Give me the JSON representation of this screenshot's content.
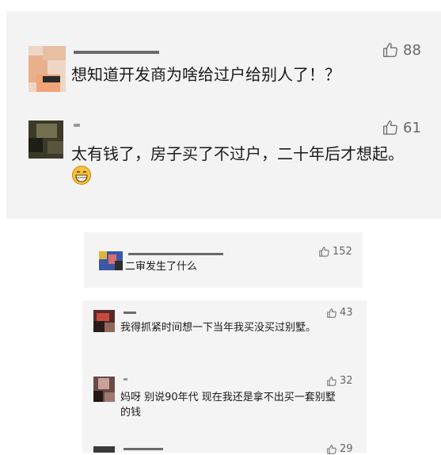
{
  "panel1": {
    "comments": [
      {
        "likes": "88",
        "text": "想知道开发商为啥给过户给别人了！？"
      },
      {
        "likes": "61",
        "text": "太有钱了，房子买了不过户，二十年后才想起。"
      }
    ],
    "emoji_icon": "grinning-face-icon"
  },
  "panel2": {
    "comments": [
      {
        "likes": "152",
        "text": "二审发生了什么"
      }
    ]
  },
  "panel3": {
    "comments": [
      {
        "likes": "43",
        "text": "我得抓紧时间想一下当年我买没买过别墅。"
      },
      {
        "likes": "32",
        "text": "妈呀 别说90年代 现在我还是拿不出买一套别墅的钱"
      },
      {
        "likes": "29",
        "text": ""
      }
    ]
  },
  "colors": {
    "panel_bg": "#f3f3f3",
    "like_icon": "#666666",
    "text": "#1a1a1a"
  }
}
